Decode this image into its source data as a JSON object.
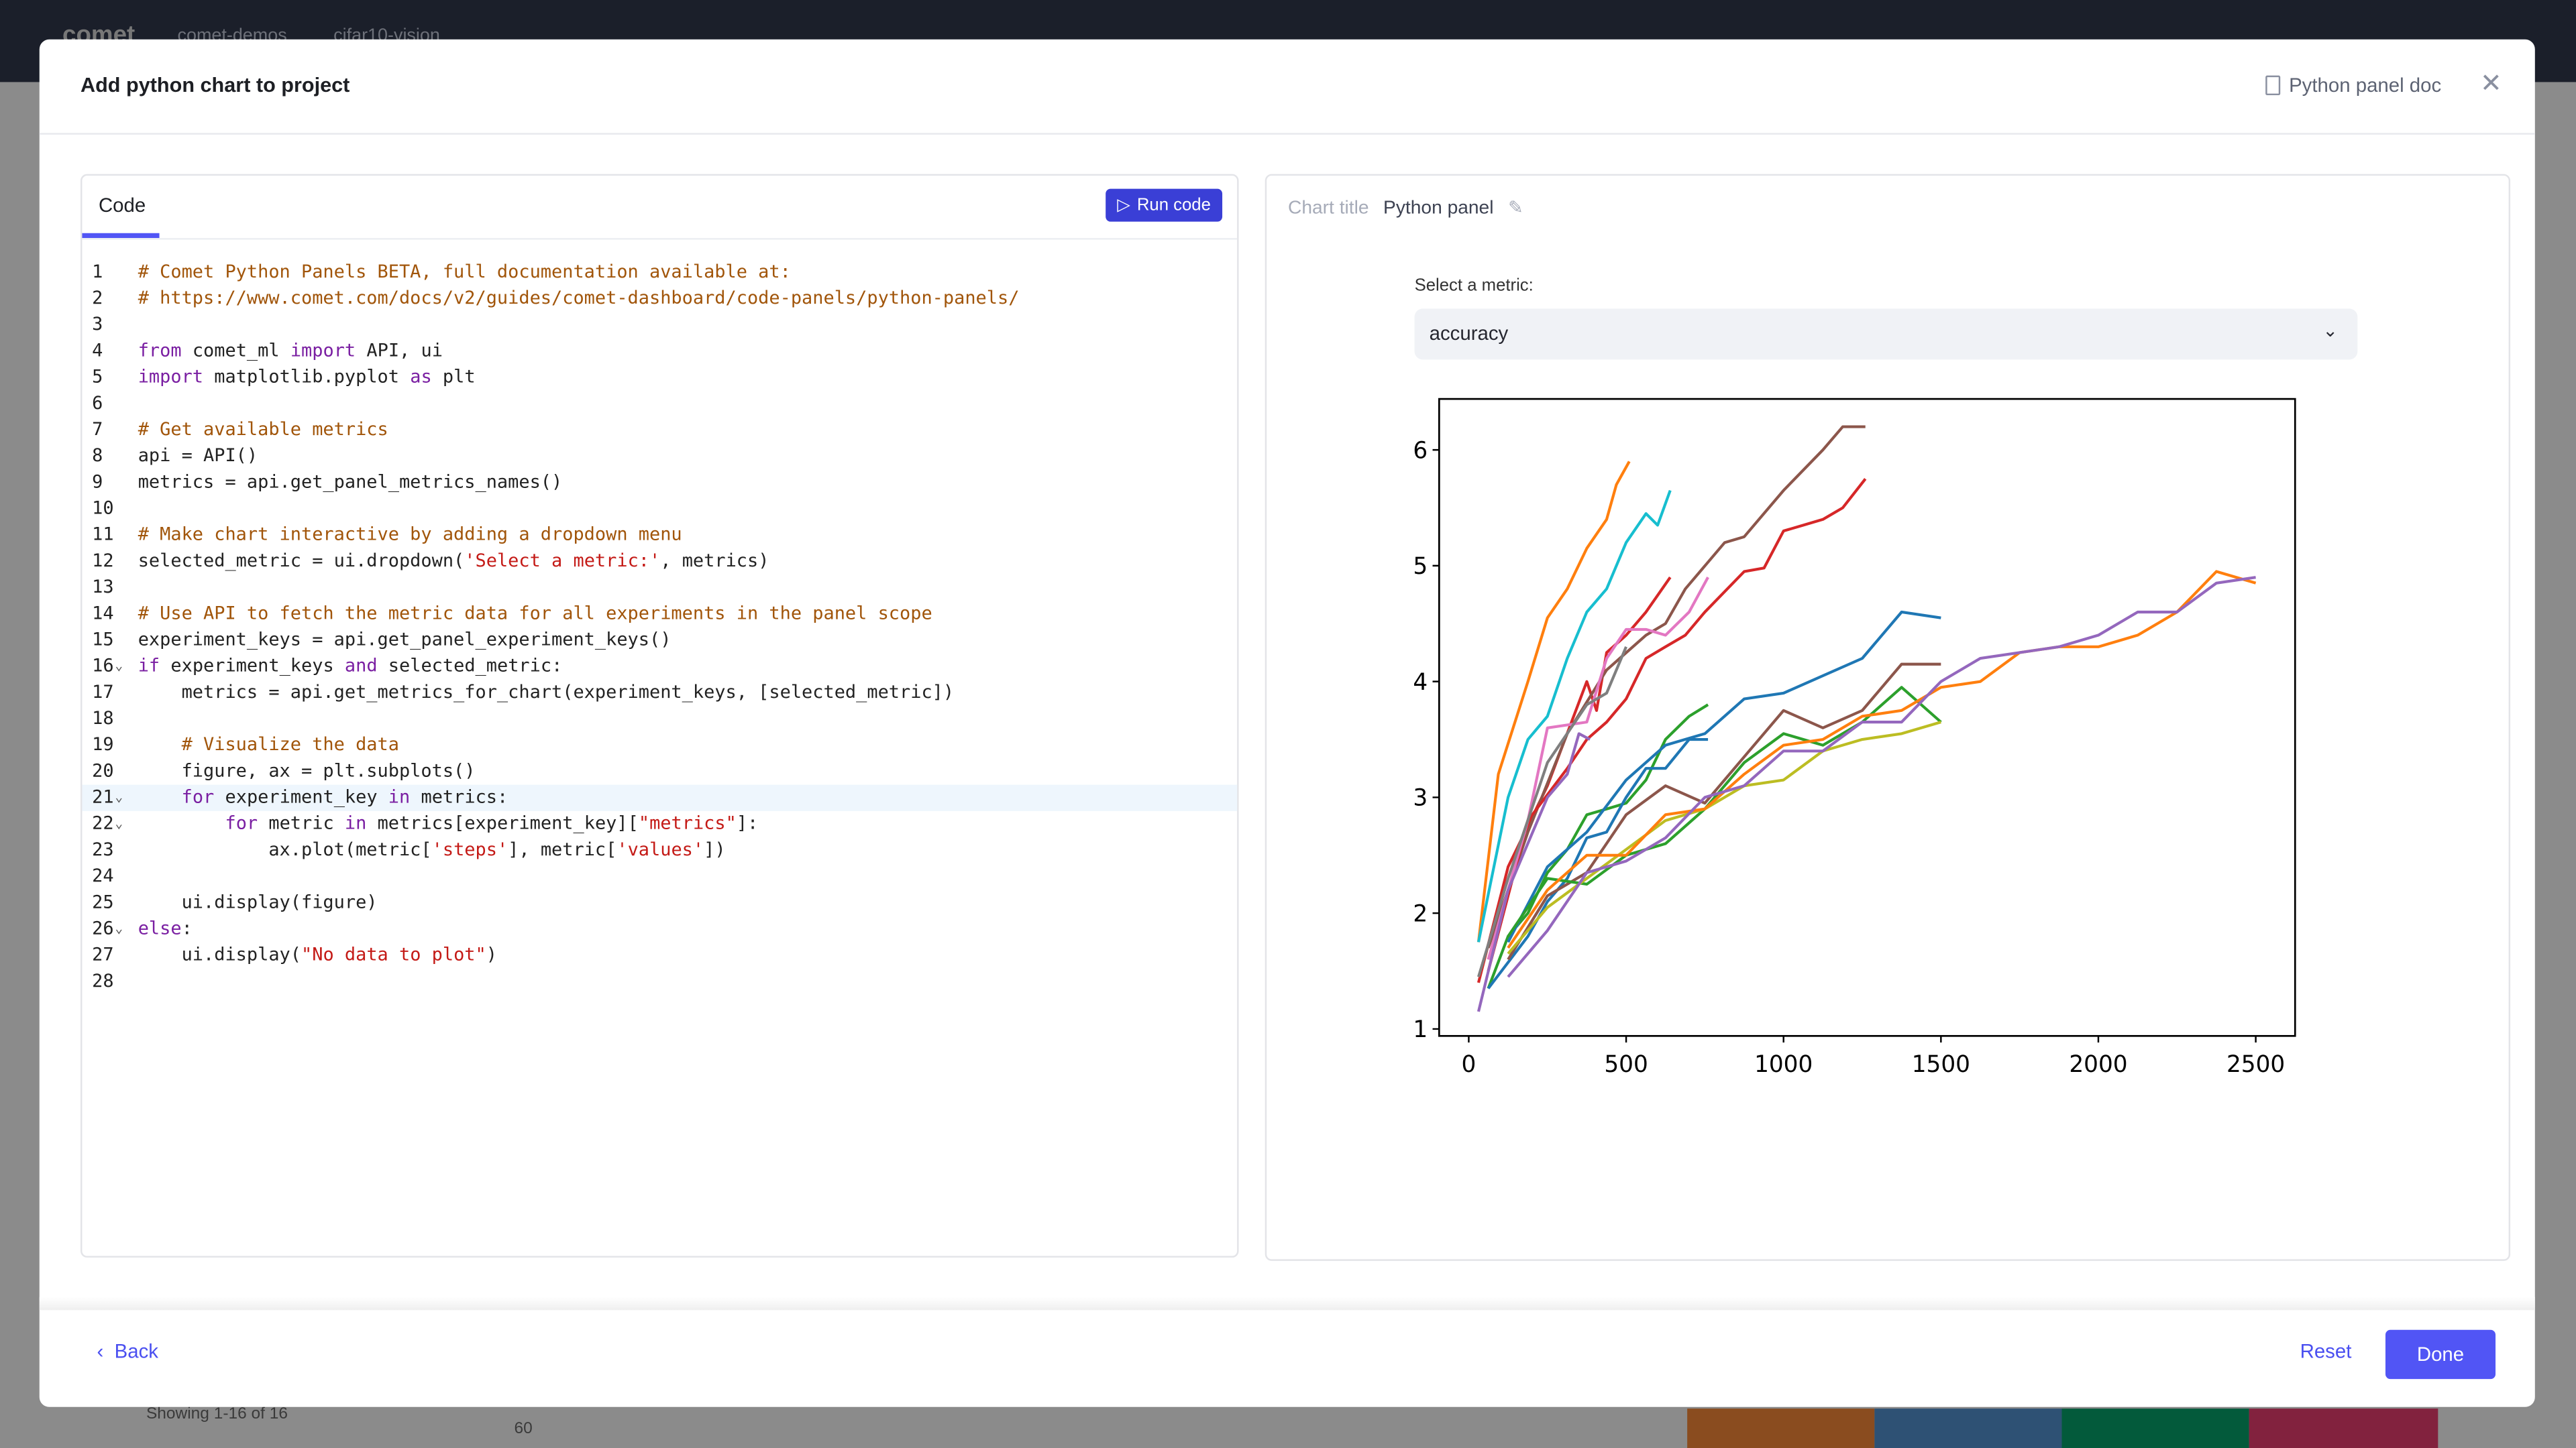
{
  "background": {
    "brand": "comet",
    "breadcrumb": [
      "comet-demos",
      "cifar10-vision"
    ],
    "pager": "Showing 1-16 of 16",
    "axis_tick": "60"
  },
  "modal": {
    "title": "Add python chart to project",
    "doc_link": "Python panel doc",
    "close_icon": "close-icon"
  },
  "code_panel": {
    "tab": "Code",
    "run_label": "Run code",
    "highlighted_line": 21,
    "lines": [
      {
        "n": "1",
        "t": [
          [
            "c",
            "# Comet Python Panels BETA, full documentation available at:"
          ]
        ]
      },
      {
        "n": "2",
        "t": [
          [
            "c",
            "# https://www.comet.com/docs/v2/guides/comet-dashboard/code-panels/python-panels/"
          ]
        ]
      },
      {
        "n": "3",
        "t": []
      },
      {
        "n": "4",
        "t": [
          [
            "k",
            "from"
          ],
          [
            "p",
            " comet_ml "
          ],
          [
            "k",
            "import"
          ],
          [
            "p",
            " API, ui"
          ]
        ]
      },
      {
        "n": "5",
        "t": [
          [
            "k",
            "import"
          ],
          [
            "p",
            " matplotlib.pyplot "
          ],
          [
            "k",
            "as"
          ],
          [
            "p",
            " plt"
          ]
        ]
      },
      {
        "n": "6",
        "t": []
      },
      {
        "n": "7",
        "t": [
          [
            "c",
            "# Get available metrics"
          ]
        ]
      },
      {
        "n": "8",
        "t": [
          [
            "p",
            "api = API()"
          ]
        ]
      },
      {
        "n": "9",
        "t": [
          [
            "p",
            "metrics = api.get_panel_metrics_names()"
          ]
        ]
      },
      {
        "n": "10",
        "t": []
      },
      {
        "n": "11",
        "t": [
          [
            "c",
            "# Make chart interactive by adding a dropdown menu"
          ]
        ]
      },
      {
        "n": "12",
        "t": [
          [
            "p",
            "selected_metric = ui.dropdown("
          ],
          [
            "s",
            "'Select a metric:'"
          ],
          [
            "p",
            ", metrics)"
          ]
        ]
      },
      {
        "n": "13",
        "t": []
      },
      {
        "n": "14",
        "t": [
          [
            "c",
            "# Use API to fetch the metric data for all experiments in the panel scope"
          ]
        ]
      },
      {
        "n": "15",
        "t": [
          [
            "p",
            "experiment_keys = api.get_panel_experiment_keys()"
          ]
        ]
      },
      {
        "n": "16",
        "fold": true,
        "t": [
          [
            "k",
            "if"
          ],
          [
            "p",
            " experiment_keys "
          ],
          [
            "k",
            "and"
          ],
          [
            "p",
            " selected_metric:"
          ]
        ]
      },
      {
        "n": "17",
        "t": [
          [
            "p",
            "    metrics = api.get_metrics_for_chart(experiment_keys, [selected_metric])"
          ]
        ]
      },
      {
        "n": "18",
        "t": []
      },
      {
        "n": "19",
        "t": [
          [
            "c",
            "    # Visualize the data"
          ]
        ]
      },
      {
        "n": "20",
        "t": [
          [
            "p",
            "    figure, ax = plt.subplots()"
          ]
        ]
      },
      {
        "n": "21",
        "fold": true,
        "t": [
          [
            "p",
            "    "
          ],
          [
            "k",
            "for"
          ],
          [
            "p",
            " experiment_key "
          ],
          [
            "k",
            "in"
          ],
          [
            "p",
            " metrics:"
          ]
        ]
      },
      {
        "n": "22",
        "fold": true,
        "t": [
          [
            "p",
            "        "
          ],
          [
            "k",
            "for"
          ],
          [
            "p",
            " metric "
          ],
          [
            "k",
            "in"
          ],
          [
            "p",
            " metrics[experiment_key]["
          ],
          [
            "s",
            "\"metrics\""
          ],
          [
            "p",
            "]:"
          ]
        ]
      },
      {
        "n": "23",
        "t": [
          [
            "p",
            "            ax.plot(metric["
          ],
          [
            "s",
            "'steps'"
          ],
          [
            "p",
            "], metric["
          ],
          [
            "s",
            "'values'"
          ],
          [
            "p",
            "])"
          ]
        ]
      },
      {
        "n": "24",
        "t": []
      },
      {
        "n": "25",
        "t": [
          [
            "p",
            "    ui.display(figure)"
          ]
        ]
      },
      {
        "n": "26",
        "fold": true,
        "t": [
          [
            "k",
            "else"
          ],
          [
            "p",
            ":"
          ]
        ]
      },
      {
        "n": "27",
        "t": [
          [
            "p",
            "    ui.display("
          ],
          [
            "s",
            "\"No data to plot\""
          ],
          [
            "p",
            ")"
          ]
        ]
      },
      {
        "n": "28",
        "t": []
      }
    ]
  },
  "chart_panel": {
    "title_label": "Chart title",
    "title_value": "Python panel",
    "select_label": "Select a metric:",
    "selected_metric": "accuracy"
  },
  "footer": {
    "back": "Back",
    "reset": "Reset",
    "done": "Done"
  },
  "colors": {
    "accent": "#5155f5",
    "run_button": "#3a3fd6",
    "topbar": "#1b1f2a"
  },
  "chart_data": {
    "type": "line",
    "title": "",
    "xlabel": "",
    "ylabel": "",
    "xlim": [
      -94,
      2625
    ],
    "ylim": [
      0.094,
      0.644
    ],
    "grid": false,
    "xticks": [
      "0",
      "500",
      "1000",
      "1500",
      "2000",
      "2500"
    ],
    "yticks": [
      "0.1",
      "0.2",
      "0.3",
      "0.4",
      "0.5",
      "0.6"
    ],
    "series": [
      {
        "color": "#ff7f0e",
        "x": [
          31,
          94,
          188,
          250,
          313,
          375,
          438,
          469,
          510
        ],
        "y": [
          0.175,
          0.32,
          0.4,
          0.455,
          0.48,
          0.515,
          0.54,
          0.57,
          0.59
        ]
      },
      {
        "color": "#17becf",
        "x": [
          31,
          125,
          188,
          250,
          313,
          375,
          438,
          500,
          563,
          600,
          640
        ],
        "y": [
          0.175,
          0.3,
          0.35,
          0.37,
          0.42,
          0.46,
          0.48,
          0.52,
          0.545,
          0.535,
          0.565
        ]
      },
      {
        "color": "#d62728",
        "x": [
          31,
          125,
          250,
          375,
          406,
          438,
          500,
          563,
          640
        ],
        "y": [
          0.14,
          0.24,
          0.31,
          0.4,
          0.375,
          0.425,
          0.44,
          0.46,
          0.49
        ]
      },
      {
        "color": "#8c564b",
        "x": [
          62,
          188,
          313,
          438,
          563,
          625,
          688,
          813,
          875,
          1000,
          1125,
          1188,
          1260
        ],
        "y": [
          0.17,
          0.27,
          0.355,
          0.41,
          0.44,
          0.45,
          0.48,
          0.52,
          0.525,
          0.565,
          0.6,
          0.62,
          0.62
        ]
      },
      {
        "color": "#d62728",
        "x": [
          62,
          188,
          313,
          375,
          438,
          500,
          563,
          625,
          688,
          750,
          875,
          938,
          1000,
          1063,
          1125,
          1188,
          1260
        ],
        "y": [
          0.15,
          0.28,
          0.325,
          0.35,
          0.365,
          0.385,
          0.42,
          0.43,
          0.44,
          0.46,
          0.495,
          0.498,
          0.53,
          0.535,
          0.54,
          0.55,
          0.575
        ]
      },
      {
        "color": "#e377c2",
        "x": [
          62,
          188,
          250,
          375,
          438,
          500,
          563,
          625,
          700,
          760
        ],
        "y": [
          0.16,
          0.28,
          0.36,
          0.365,
          0.42,
          0.445,
          0.445,
          0.44,
          0.46,
          0.49
        ]
      },
      {
        "color": "#7f7f7f",
        "x": [
          31,
          125,
          250,
          375,
          438,
          500
        ],
        "y": [
          0.145,
          0.23,
          0.33,
          0.38,
          0.39,
          0.43
        ]
      },
      {
        "color": "#9467bd",
        "x": [
          31,
          125,
          250,
          313,
          350,
          385
        ],
        "y": [
          0.115,
          0.22,
          0.3,
          0.32,
          0.355,
          0.35
        ]
      },
      {
        "color": "#2ca02c",
        "x": [
          62,
          125,
          188,
          250,
          313,
          375,
          438,
          500,
          563,
          625,
          700,
          760
        ],
        "y": [
          0.135,
          0.18,
          0.2,
          0.235,
          0.255,
          0.285,
          0.29,
          0.295,
          0.315,
          0.35,
          0.37,
          0.38
        ]
      },
      {
        "color": "#1f77b4",
        "x": [
          62,
          188,
          250,
          313,
          375,
          438,
          500,
          563,
          625,
          700,
          760
        ],
        "y": [
          0.135,
          0.18,
          0.21,
          0.23,
          0.265,
          0.27,
          0.3,
          0.325,
          0.325,
          0.35,
          0.35
        ]
      },
      {
        "color": "#1f77b4",
        "x": [
          125,
          250,
          375,
          500,
          625,
          750,
          875,
          1000,
          1125,
          1250,
          1375,
          1500
        ],
        "y": [
          0.175,
          0.24,
          0.27,
          0.315,
          0.345,
          0.355,
          0.385,
          0.39,
          0.405,
          0.42,
          0.46,
          0.455
        ]
      },
      {
        "color": "#8c564b",
        "x": [
          125,
          250,
          375,
          500,
          625,
          750,
          875,
          1000,
          1125,
          1250,
          1375,
          1500
        ],
        "y": [
          0.16,
          0.215,
          0.235,
          0.285,
          0.31,
          0.295,
          0.335,
          0.375,
          0.36,
          0.375,
          0.415,
          0.415
        ]
      },
      {
        "color": "#2ca02c",
        "x": [
          125,
          250,
          375,
          500,
          625,
          750,
          875,
          1000,
          1125,
          1250,
          1375,
          1500
        ],
        "y": [
          0.18,
          0.23,
          0.225,
          0.25,
          0.26,
          0.29,
          0.33,
          0.355,
          0.345,
          0.365,
          0.395,
          0.365
        ]
      },
      {
        "color": "#bcbd22",
        "x": [
          125,
          250,
          375,
          500,
          625,
          750,
          875,
          1000,
          1125,
          1250,
          1375,
          1500
        ],
        "y": [
          0.165,
          0.205,
          0.23,
          0.255,
          0.28,
          0.29,
          0.31,
          0.315,
          0.34,
          0.35,
          0.355,
          0.365
        ]
      },
      {
        "color": "#ff7f0e",
        "x": [
          125,
          250,
          375,
          500,
          625,
          750,
          875,
          1000,
          1125,
          1250,
          1375,
          1500,
          1625,
          1750,
          1875,
          2000,
          2125,
          2250,
          2375,
          2500
        ],
        "y": [
          0.17,
          0.22,
          0.25,
          0.25,
          0.285,
          0.29,
          0.32,
          0.345,
          0.35,
          0.37,
          0.375,
          0.395,
          0.4,
          0.425,
          0.43,
          0.43,
          0.44,
          0.46,
          0.495,
          0.485
        ]
      },
      {
        "color": "#9467bd",
        "x": [
          125,
          250,
          375,
          500,
          625,
          750,
          875,
          1000,
          1125,
          1250,
          1375,
          1500,
          1625,
          1750,
          1875,
          2000,
          2125,
          2250,
          2375,
          2500
        ],
        "y": [
          0.145,
          0.185,
          0.235,
          0.245,
          0.265,
          0.3,
          0.31,
          0.34,
          0.34,
          0.365,
          0.365,
          0.4,
          0.42,
          0.425,
          0.43,
          0.44,
          0.46,
          0.46,
          0.485,
          0.49
        ]
      }
    ]
  }
}
